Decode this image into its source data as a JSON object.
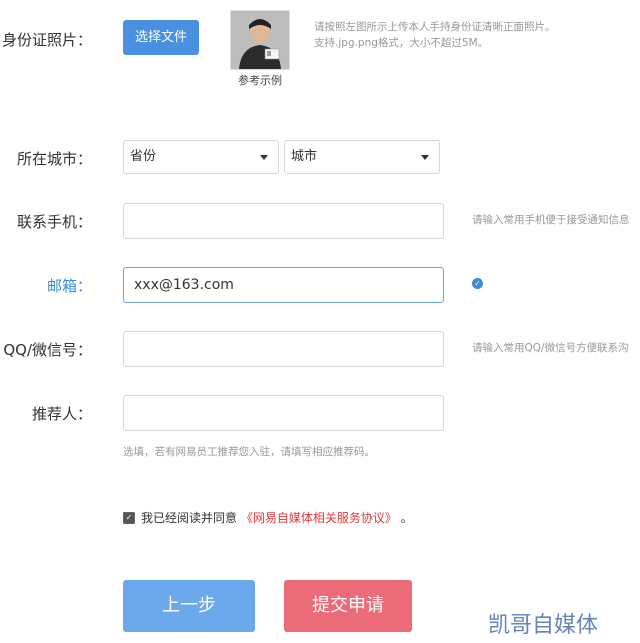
{
  "form": {
    "id_photo": {
      "label": "身份证照片：",
      "upload_button": "选择文件",
      "sample_caption": "参考示例",
      "hint_line1": "请按照左图所示上传本人手持身份证清晰正面照片。",
      "hint_line2": "支持.jpg.png格式，大小不超过5M。"
    },
    "city": {
      "label": "所在城市：",
      "province_value": "省份",
      "city_value": "城市"
    },
    "phone": {
      "label": "联系手机：",
      "value": "",
      "hint": "请输入常用手机便于接受通知信息"
    },
    "email": {
      "label": "邮箱：",
      "value": "xxx@163.com"
    },
    "qq_wechat": {
      "label": "QQ/微信号：",
      "value": "",
      "hint": "请输入常用QQ/微信号方便联系沟"
    },
    "referrer": {
      "label": "推荐人：",
      "value": "",
      "hint": "选填，若有网易员工推荐您入驻，请填写相应推荐码。"
    },
    "agreement": {
      "text": "我已经阅读并同意",
      "link": "《网易自媒体相关服务协议》",
      "suffix": "。",
      "checked": true
    },
    "buttons": {
      "prev": "上一步",
      "submit": "提交申请"
    }
  },
  "watermark": "凯哥自媒体",
  "colors": {
    "upload_button": "#4a90e2",
    "prev_button": "#6ba8ec",
    "submit_button": "#eb6b79",
    "link": "#e4393c",
    "active_label": "#3b8cd6"
  }
}
